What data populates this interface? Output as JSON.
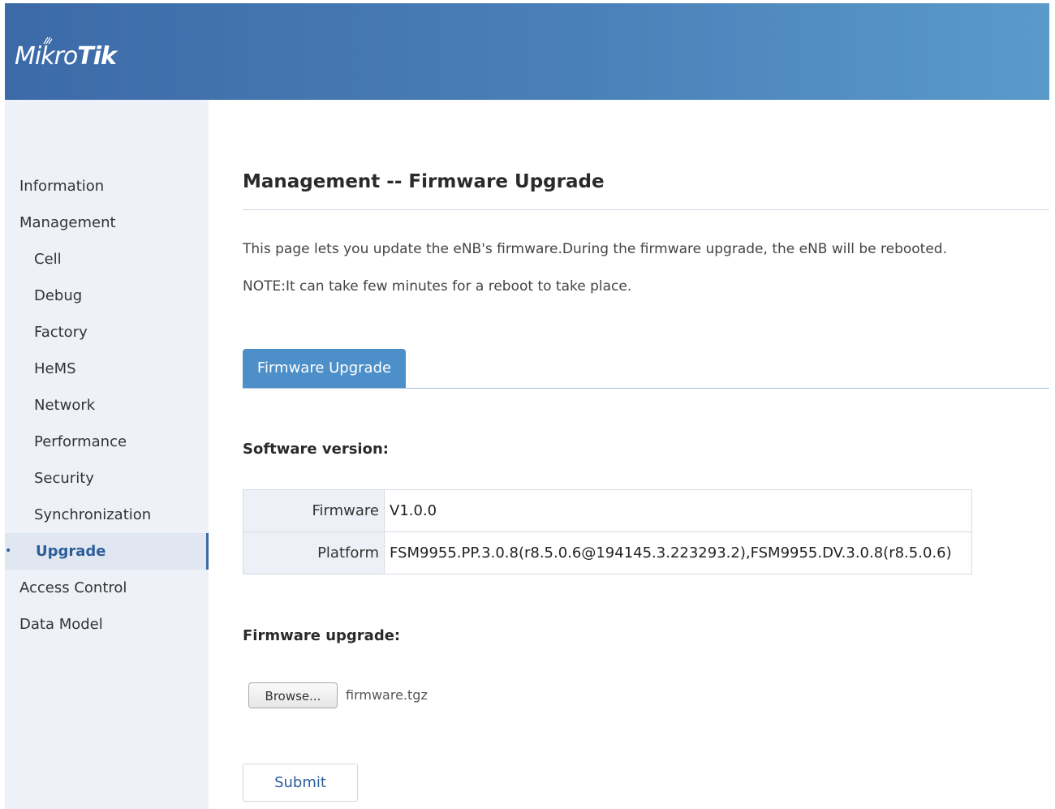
{
  "header": {
    "logo_part1": "Mikro",
    "logo_part2": "Tik"
  },
  "sidebar": {
    "items": [
      {
        "label": "Information",
        "level": 1
      },
      {
        "label": "Management",
        "level": 1
      },
      {
        "label": "Cell",
        "level": 2
      },
      {
        "label": "Debug",
        "level": 2
      },
      {
        "label": "Factory",
        "level": 2
      },
      {
        "label": "HeMS",
        "level": 2
      },
      {
        "label": "Network",
        "level": 2
      },
      {
        "label": "Performance",
        "level": 2
      },
      {
        "label": "Security",
        "level": 2
      },
      {
        "label": "Synchronization",
        "level": 2
      },
      {
        "label": "Upgrade",
        "level": 2,
        "active": true,
        "bullet": "•"
      },
      {
        "label": "Access Control",
        "level": 1
      },
      {
        "label": "Data Model",
        "level": 1
      }
    ]
  },
  "main": {
    "title": "Management -- Firmware Upgrade",
    "description": "This page lets you update the eNB's firmware.During the firmware upgrade, the eNB will be rebooted.",
    "note": "NOTE:It can take few minutes for a reboot to take place.",
    "tab_label": "Firmware Upgrade",
    "software_version_heading": "Software version:",
    "version_table": [
      {
        "key": "Firmware",
        "value": "V1.0.0"
      },
      {
        "key": "Platform",
        "value": "FSM9955.PP.3.0.8(r8.5.0.6@194145.3.223293.2),FSM9955.DV.3.0.8(r8.5.0.6)"
      }
    ],
    "firmware_upgrade_heading": "Firmware upgrade:",
    "browse_label": "Browse...",
    "file_name": "firmware.tgz",
    "submit_label": "Submit"
  },
  "colors": {
    "header_start": "#3c6aa8",
    "header_end": "#5a9aca",
    "tab_active": "#4d8fc8",
    "sidebar_bg": "#eef2f8",
    "active_text": "#2c5d99"
  }
}
